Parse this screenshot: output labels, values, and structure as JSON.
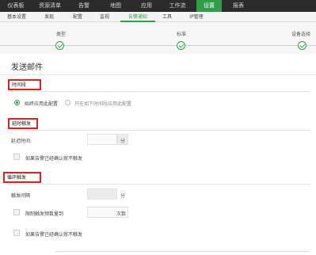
{
  "topnav": {
    "items": [
      "仪表板",
      "资源清单",
      "告警",
      "地图",
      "应用",
      "工作流",
      "设置",
      "报表"
    ],
    "active": 6
  },
  "subnav": {
    "items": [
      "基本设置",
      "发现",
      "配置",
      "监视",
      "告警通知",
      "工具",
      "IP管理"
    ],
    "active": 4
  },
  "steps": {
    "labels": [
      "类型",
      "标准",
      "设备选择"
    ]
  },
  "page": {
    "title": "发送邮件"
  },
  "time_section": {
    "label": "时间段",
    "option_always": "始终应用此配置",
    "option_specific": "只在如下时间段应用此配置"
  },
  "delay_section": {
    "label": "延时触发",
    "delay_time_label": "延迟时间:",
    "delay_unit": "分",
    "skip_if_ack": "如果告警已经确认就不触发"
  },
  "repeat_section": {
    "label": "循环触发",
    "interval_label": "触发间隔",
    "interval_unit": "分",
    "limit_label": "限制触发频数量到",
    "limit_unit": "次数",
    "skip_if_ack": "如果告警已经确认就不触发"
  },
  "colors": {
    "accent": "#2e9e4a",
    "highlight": "#e02020",
    "nav_bg": "#2b2b2b"
  }
}
